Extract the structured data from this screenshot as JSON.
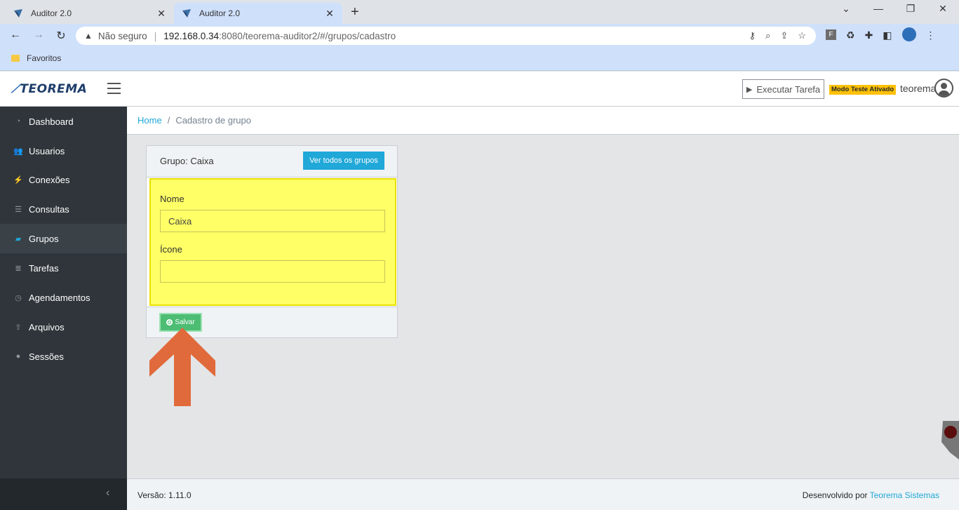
{
  "browser": {
    "tabs": [
      {
        "title": "Auditor 2.0",
        "active": false
      },
      {
        "title": "Auditor 2.0",
        "active": true
      }
    ],
    "address": {
      "security_label": "Não seguro",
      "host": "192.168.0.34",
      "path": ":8080/teorema-auditor2/#/grupos/cadastro"
    },
    "bookmarks": [
      {
        "label": "Favoritos"
      }
    ]
  },
  "header": {
    "logo_text": "TEOREMA",
    "execute_task_label": "Executar Tarefa",
    "test_mode_badge": "Modo Teste Ativado",
    "username": "teorema"
  },
  "sidebar": {
    "items": [
      {
        "label": "Dashboard",
        "icon": "dashboard-icon",
        "active": false
      },
      {
        "label": "Usuarios",
        "icon": "users-icon",
        "active": false
      },
      {
        "label": "Conexões",
        "icon": "plug-icon",
        "active": false
      },
      {
        "label": "Consultas",
        "icon": "database-icon",
        "active": false
      },
      {
        "label": "Grupos",
        "icon": "folder-open-icon",
        "active": true
      },
      {
        "label": "Tarefas",
        "icon": "tasks-icon",
        "active": false
      },
      {
        "label": "Agendamentos",
        "icon": "clock-icon",
        "active": false
      },
      {
        "label": "Arquivos",
        "icon": "upload-icon",
        "active": false
      },
      {
        "label": "Sessões",
        "icon": "user-icon",
        "active": false
      }
    ]
  },
  "breadcrumb": {
    "home": "Home",
    "current": "Cadastro de grupo"
  },
  "card": {
    "title": "Grupo: Caixa",
    "view_all_label": "Ver todos os grupos",
    "fields": {
      "name_label": "Nome",
      "name_value": "Caixa",
      "icon_label": "Ícone",
      "icon_value": ""
    },
    "save_label": "Salvar"
  },
  "footer": {
    "version": "Versão: 1.11.0",
    "developed_by": "Desenvolvido por",
    "company": "Teorema Sistemas"
  },
  "colors": {
    "sidebar_bg": "#2f353a",
    "accent": "#20a8d8",
    "success": "#4dbd74",
    "highlight": "#ffff66",
    "annotation_arrow": "#e06a3b",
    "badge": "#ffc107"
  }
}
